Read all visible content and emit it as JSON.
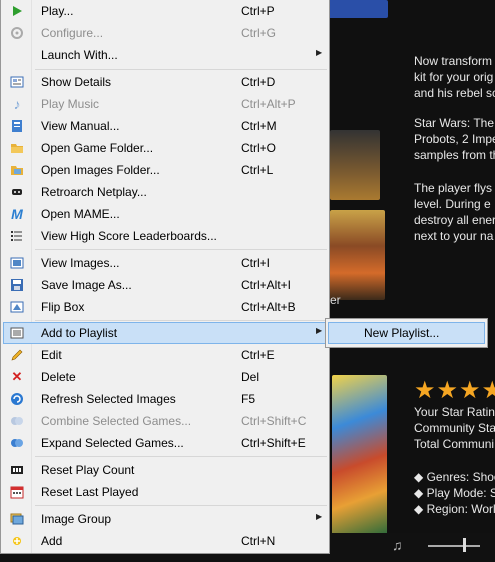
{
  "background": {
    "description_lines_1": [
      "Now transform",
      "kit for your orig",
      "and his rebel sc"
    ],
    "description_lines_2": [
      "Star Wars: The",
      "Probots, 2 Impe",
      "samples from th"
    ],
    "description_lines_3": [
      "The player flys",
      "level. During e",
      "destroy all ener",
      "next to your na"
    ],
    "cut_text": "er",
    "stars": "★★★★",
    "rating_lines": [
      "Your Star Rating",
      "Community Sta",
      "Total Communi"
    ],
    "genre_lines": [
      "◆  Genres: Shoo",
      "◆  Play Mode: S",
      "◆  Region: Worl"
    ]
  },
  "menu": {
    "items": [
      {
        "label": "Play...",
        "shortcut": "Ctrl+P",
        "icon": "play-icon",
        "disabled": false
      },
      {
        "label": "Configure...",
        "shortcut": "Ctrl+G",
        "icon": "configure-icon",
        "disabled": true
      },
      {
        "label": "Launch With...",
        "shortcut": "",
        "icon": "",
        "disabled": false,
        "submenu": true
      },
      {
        "label": "Show Details",
        "shortcut": "Ctrl+D",
        "icon": "details-icon",
        "disabled": false
      },
      {
        "label": "Play Music",
        "shortcut": "Ctrl+Alt+P",
        "icon": "music-note-icon",
        "disabled": true
      },
      {
        "label": "View Manual...",
        "shortcut": "Ctrl+M",
        "icon": "manual-icon",
        "disabled": false
      },
      {
        "label": "Open Game Folder...",
        "shortcut": "Ctrl+O",
        "icon": "folder-icon",
        "disabled": false
      },
      {
        "label": "Open Images Folder...",
        "shortcut": "Ctrl+L",
        "icon": "images-folder-icon",
        "disabled": false
      },
      {
        "label": "Retroarch Netplay...",
        "shortcut": "",
        "icon": "netplay-icon",
        "disabled": false
      },
      {
        "label": "Open MAME...",
        "shortcut": "",
        "icon": "mame-icon",
        "disabled": false
      },
      {
        "label": "View High Score Leaderboards...",
        "shortcut": "",
        "icon": "leaderboard-icon",
        "disabled": false
      },
      {
        "label": "View Images...",
        "shortcut": "Ctrl+I",
        "icon": "view-images-icon",
        "disabled": false
      },
      {
        "label": "Save Image As...",
        "shortcut": "Ctrl+Alt+I",
        "icon": "save-image-icon",
        "disabled": false
      },
      {
        "label": "Flip Box",
        "shortcut": "Ctrl+Alt+B",
        "icon": "flip-box-icon",
        "disabled": false
      },
      {
        "label": "Add to Playlist",
        "shortcut": "",
        "icon": "playlist-icon",
        "disabled": false,
        "submenu": true,
        "highlighted": true
      },
      {
        "label": "Edit",
        "shortcut": "Ctrl+E",
        "icon": "pencil-icon",
        "disabled": false
      },
      {
        "label": "Delete",
        "shortcut": "Del",
        "icon": "delete-icon",
        "disabled": false
      },
      {
        "label": "Refresh Selected Images",
        "shortcut": "F5",
        "icon": "refresh-icon",
        "disabled": false
      },
      {
        "label": "Combine Selected Games...",
        "shortcut": "Ctrl+Shift+C",
        "icon": "combine-icon",
        "disabled": true
      },
      {
        "label": "Expand Selected Games...",
        "shortcut": "Ctrl+Shift+E",
        "icon": "expand-icon",
        "disabled": false
      },
      {
        "label": "Reset Play Count",
        "shortcut": "",
        "icon": "counter-icon",
        "disabled": false
      },
      {
        "label": "Reset Last Played",
        "shortcut": "",
        "icon": "calendar-icon",
        "disabled": false
      },
      {
        "label": "Image Group",
        "shortcut": "",
        "icon": "image-group-icon",
        "disabled": false,
        "submenu": true
      },
      {
        "label": "Add",
        "shortcut": "Ctrl+N",
        "icon": "add-icon",
        "disabled": false
      }
    ],
    "arrow_glyph": "▶"
  },
  "submenu": {
    "new_playlist_label": "New Playlist..."
  },
  "player": {
    "note_glyph": "♫"
  },
  "colors": {
    "highlight": "#c9e0f7",
    "highlight_border": "#7eb4ea",
    "star": "#f5a623"
  }
}
